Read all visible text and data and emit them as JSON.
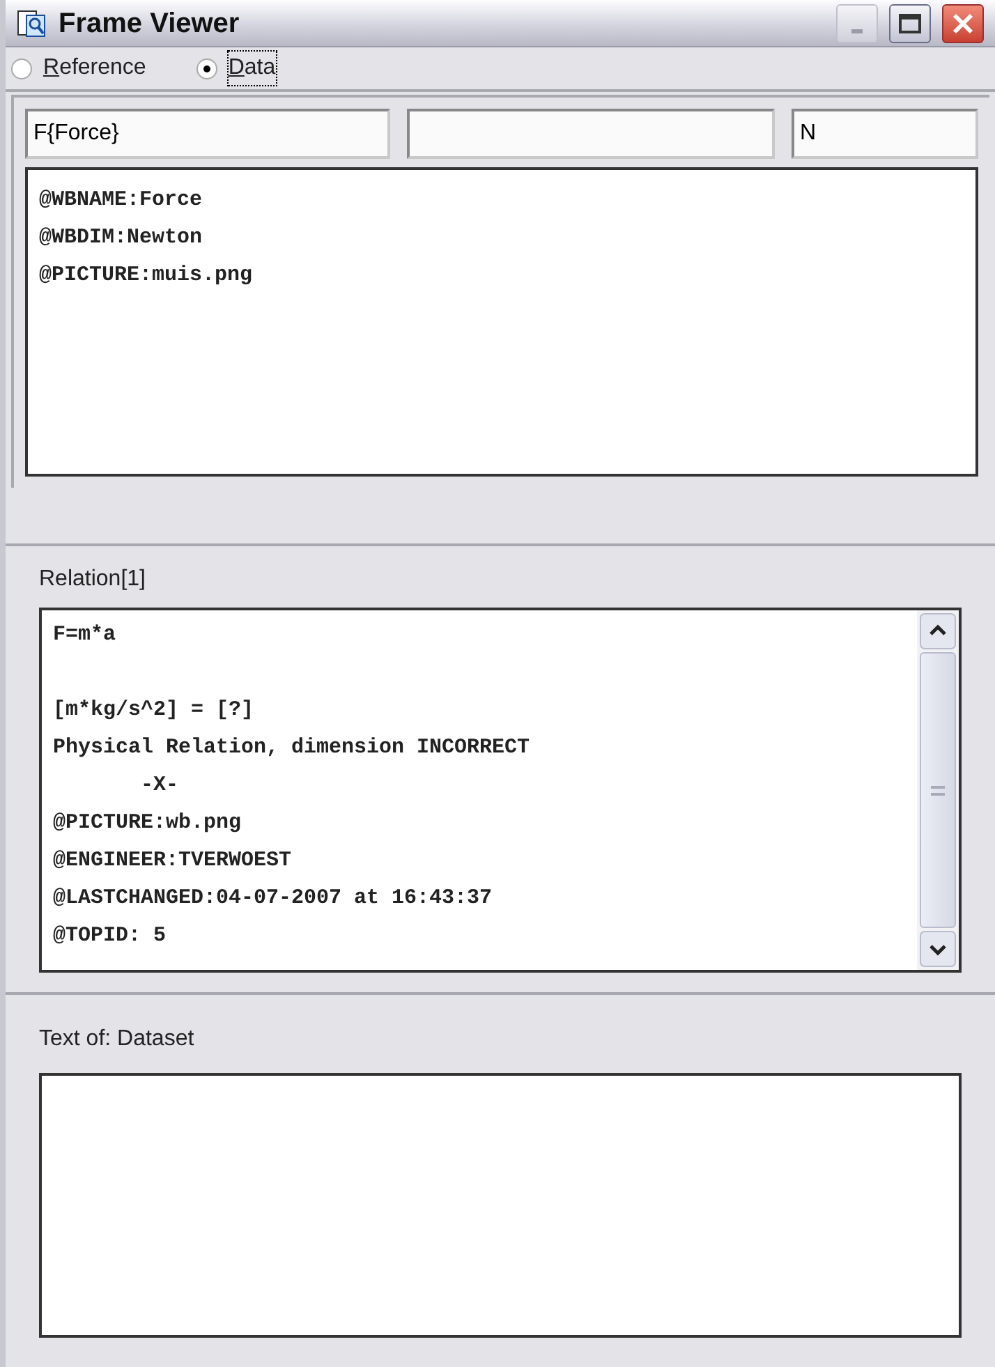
{
  "window": {
    "title": "Frame Viewer"
  },
  "mode_options": [
    {
      "label": "Reference",
      "selected": false
    },
    {
      "label": "Data",
      "selected": true
    }
  ],
  "name_field": {
    "value": "F{Force}"
  },
  "unit_field": {
    "value": "N"
  },
  "frame_text": {
    "lines": [
      "@WBNAME:Force",
      "@WBDIM:Newton",
      "@PICTURE:muis.png"
    ]
  },
  "relation_panel": {
    "title": "Relation[1]",
    "formula": "F=m*a",
    "lines": [
      "[m*kg/s^2] = [?]",
      "Physical Relation, dimension INCORRECT",
      "       -X-",
      "@PICTURE:wb.png",
      "@ENGINEER:TVERWOEST",
      "@LASTCHANGED:04-07-2007 at 16:43:37",
      "@TOPID: 5"
    ]
  },
  "dataset_panel": {
    "title": "Text of: Dataset"
  }
}
